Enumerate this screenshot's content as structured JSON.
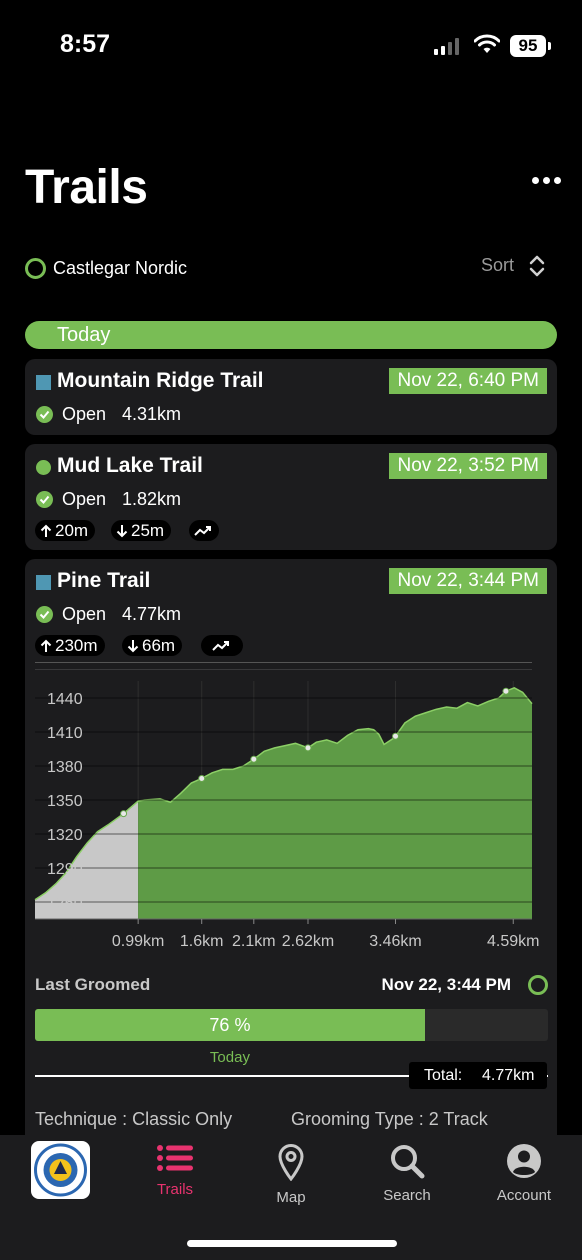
{
  "status_bar": {
    "time": "8:57",
    "battery": "95"
  },
  "header": {
    "title": "Trails",
    "location": "Castlegar Nordic",
    "sort_label": "Sort"
  },
  "section": {
    "label": "Today"
  },
  "colors": {
    "accent": "#79bd55",
    "blue_square": "#4f97b3",
    "card_bg": "#1c1c1e",
    "tab_active": "#e8336f"
  },
  "trails": [
    {
      "name": "Mountain Ridge Trail",
      "icon": "blue-square-icon",
      "date": "Nov 22, 6:40 PM",
      "status": "Open",
      "distance": "4.31km"
    },
    {
      "name": "Mud Lake Trail",
      "icon": "green-circle-icon",
      "date": "Nov 22, 3:52 PM",
      "status": "Open",
      "distance": "1.82km",
      "ascent": "20m",
      "descent": "25m"
    },
    {
      "name": "Pine Trail",
      "icon": "blue-square-icon",
      "date": "Nov 22, 3:44 PM",
      "status": "Open",
      "distance": "4.77km",
      "ascent": "230m",
      "descent": "66m"
    }
  ],
  "chart_data": {
    "type": "area",
    "title": "",
    "xlabel": "",
    "ylabel": "",
    "ylim": [
      1245,
      1455
    ],
    "xlim": [
      0,
      4.77
    ],
    "y_ticks": [
      "1440",
      "1410",
      "1380",
      "1350",
      "1320",
      "1290",
      "1260"
    ],
    "x_ticks": [
      "0.99km",
      "1.6km",
      "2.1km",
      "2.62km",
      "3.46km",
      "4.59km"
    ],
    "x_tick_values": [
      0.99,
      1.6,
      2.1,
      2.62,
      3.46,
      4.59
    ],
    "x": [
      0,
      0.1,
      0.2,
      0.3,
      0.4,
      0.5,
      0.6,
      0.7,
      0.85,
      0.99,
      1.05,
      1.2,
      1.3,
      1.4,
      1.5,
      1.6,
      1.7,
      1.8,
      1.9,
      2.0,
      2.1,
      2.2,
      2.3,
      2.4,
      2.5,
      2.62,
      2.7,
      2.8,
      2.9,
      3.0,
      3.1,
      3.2,
      3.25,
      3.3,
      3.35,
      3.45,
      3.55,
      3.65,
      3.75,
      3.85,
      3.95,
      4.05,
      4.15,
      4.25,
      4.35,
      4.45,
      4.52,
      4.6,
      4.68,
      4.77
    ],
    "y": [
      1262,
      1268,
      1276,
      1286,
      1300,
      1312,
      1322,
      1328,
      1338,
      1349,
      1350,
      1351,
      1348,
      1356,
      1365,
      1369,
      1374,
      1377,
      1377,
      1380,
      1386,
      1393,
      1396,
      1398,
      1400,
      1396,
      1401,
      1403,
      1400,
      1407,
      1412,
      1413,
      1412,
      1408,
      1399,
      1405,
      1418,
      1424,
      1427,
      1430,
      1432,
      1431,
      1436,
      1433,
      1437,
      1440,
      1446,
      1449,
      1445,
      1435
    ],
    "highlight_until_x": 0.99,
    "markers_x": [
      0.85,
      1.6,
      2.1,
      2.62,
      3.46,
      4.52
    ],
    "area_color": "#5e9b46",
    "highlight_color": "#c8c8c8"
  },
  "grooming": {
    "last_groomed_label": "Last Groomed",
    "last_groomed_date": "Nov 22, 3:44 PM",
    "progress_percent": 76,
    "progress_label": "76 %",
    "progress_sub": "Today",
    "total_label": "Total:",
    "total_value": "4.77km",
    "technique": "Technique : Classic Only",
    "grooming_type": "Grooming Type : 2 Track"
  },
  "tab_bar": {
    "tabs": [
      {
        "label": "Trails",
        "icon": "list-icon",
        "active": true
      },
      {
        "label": "Map",
        "icon": "map-pin-icon",
        "active": false
      },
      {
        "label": "Search",
        "icon": "search-icon",
        "active": false
      },
      {
        "label": "Account",
        "icon": "account-icon",
        "active": false
      }
    ]
  }
}
